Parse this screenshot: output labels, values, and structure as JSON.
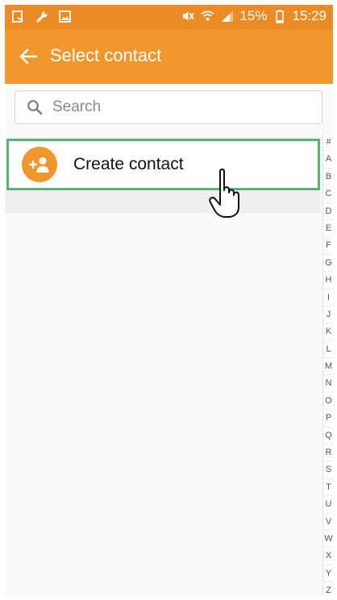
{
  "status_bar": {
    "battery_percent": "15%",
    "time": "15:29",
    "icons": [
      "notification-icon",
      "wrench-icon",
      "image-icon",
      "mute-icon",
      "wifi-icon",
      "signal-icon",
      "battery-icon"
    ]
  },
  "app_bar": {
    "title": "Select contact"
  },
  "search": {
    "placeholder": "Search",
    "value": ""
  },
  "create_contact": {
    "label": "Create contact"
  },
  "index_letters": [
    "#",
    "A",
    "B",
    "C",
    "D",
    "E",
    "F",
    "G",
    "H",
    "I",
    "J",
    "K",
    "L",
    "M",
    "N",
    "O",
    "P",
    "Q",
    "R",
    "S",
    "T",
    "U",
    "V",
    "W",
    "X",
    "Y",
    "Z"
  ],
  "colors": {
    "status_bar": "#ea8b26",
    "app_bar": "#f0962d",
    "highlight": "#54b673",
    "avatar": "#f0962d"
  }
}
